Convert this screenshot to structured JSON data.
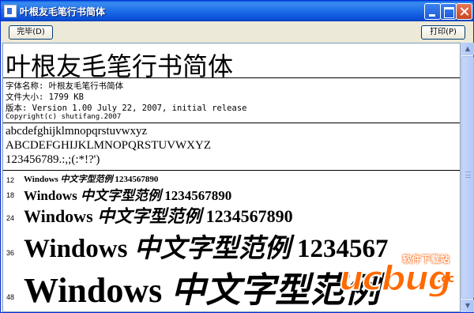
{
  "window": {
    "title": "叶根友毛笔行书简体"
  },
  "toolbar": {
    "done_label": "完毕(D)",
    "print_label": "打印(P)"
  },
  "header": {
    "font_name_display": "叶根友毛笔行书简体"
  },
  "info": {
    "name_line": "字体名称: 叶根友毛笔行书简体",
    "size_line": "文件大小: 1799 KB",
    "version_line": "版本: Version 1.00 July 22, 2007, initial release",
    "copyright_line": "Copyright(c) shutifang.2007"
  },
  "charset": {
    "lower": "abcdefghijklmnopqrstuvwxyz",
    "upper": "ABCDEFGHIJKLMNOPQRSTUVWXYZ",
    "digits": "123456789.:,;(:*!?')"
  },
  "samples": [
    {
      "size": "12",
      "latin": "Windows",
      "cjk": "中文字型范例",
      "digits": "1234567890"
    },
    {
      "size": "18",
      "latin": "Windows",
      "cjk": "中文字型范例",
      "digits": "1234567890"
    },
    {
      "size": "24",
      "latin": "Windows",
      "cjk": "中文字型范例",
      "digits": "1234567890"
    },
    {
      "size": "36",
      "latin": "Windows",
      "cjk": "中文字型范例",
      "digits": "1234567"
    },
    {
      "size": "48",
      "latin": "Windows",
      "cjk": "中文字型范例",
      "digits": ""
    }
  ],
  "watermark": {
    "caption": "软件下载站",
    "logo": "ucbug",
    "suffix": ".cc"
  },
  "colors": {
    "titlebar": "#0a5fe0",
    "window_bg": "#ece9d8",
    "watermark": "#ff6a00"
  }
}
